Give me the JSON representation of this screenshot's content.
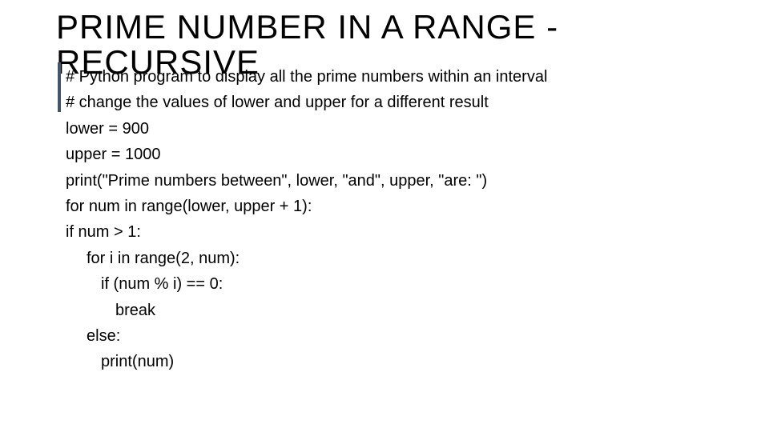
{
  "title_line1": "PRIME NUMBER IN A RANGE -",
  "title_line2": "RECURSIVE",
  "code": {
    "l1": "# Python program to display all the prime numbers within an interval",
    "l2": "# change the values of lower and upper for a different result",
    "l3": "lower = 900",
    "l4": "upper = 1000",
    "l5": "print(\"Prime numbers between\", lower, \"and\", upper, \"are: \")",
    "l6": "for num in range(lower, upper + 1):",
    "l7": "if num > 1:",
    "l8": "for i in range(2, num):",
    "l9": "if (num % i) == 0:",
    "l10": "break",
    "l11": "else:",
    "l12": "print(num)"
  }
}
